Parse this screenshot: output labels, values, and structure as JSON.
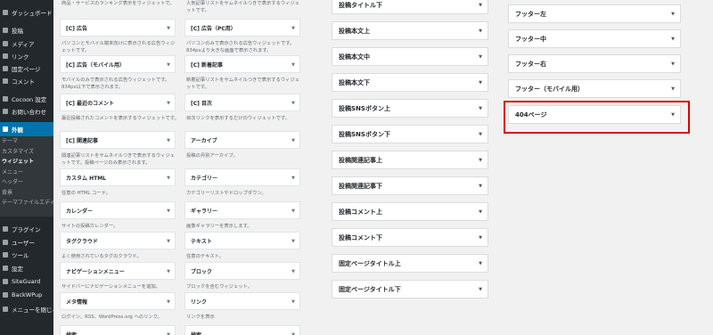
{
  "sidebar": {
    "items": [
      {
        "label": "ダッシュボード",
        "icon": "dashboard-icon"
      },
      {
        "label": "投稿",
        "icon": "pin-icon"
      },
      {
        "label": "メディア",
        "icon": "media-icon"
      },
      {
        "label": "リンク",
        "icon": "link-icon"
      },
      {
        "label": "固定ページ",
        "icon": "page-icon"
      },
      {
        "label": "コメント",
        "icon": "comment-icon"
      },
      {
        "label": "Cocoon 設定",
        "icon": "cocoon-icon"
      },
      {
        "label": "お問い合わせ",
        "icon": "mail-icon"
      },
      {
        "label": "外観",
        "icon": "appearance-icon"
      },
      {
        "label": "プラグイン",
        "icon": "plugin-icon"
      },
      {
        "label": "ユーザー",
        "icon": "user-icon"
      },
      {
        "label": "ツール",
        "icon": "wrench-icon"
      },
      {
        "label": "設定",
        "icon": "settings-icon"
      },
      {
        "label": "SiteGuard",
        "icon": "shield-icon"
      },
      {
        "label": "BackWPup",
        "icon": "backup-icon"
      },
      {
        "label": "メニューを閉じる",
        "icon": "collapse-icon"
      }
    ],
    "submenu": [
      "テーマ",
      "カスタマイズ",
      "ウィジェット",
      "メニュー",
      "ヘッダー",
      "背景",
      "テーマファイルエディター"
    ],
    "active_color": "#0073aa"
  },
  "available_widgets": {
    "col1": [
      {
        "name": "",
        "desc": "商品・サービスのランキング表示をウィジェットで。"
      },
      {
        "name": "[C] 広告",
        "desc": "パソコンとモバイル端末向けに表示される広告ウィジェットです。"
      },
      {
        "name": "[C] 広告（モバイル用）",
        "desc": "モバイルのみで表示される広告ウィジェットです。834px以下で表示されます。"
      },
      {
        "name": "[C] 最近のコメント",
        "desc": "最近投稿されたコメントを表示するウィジェットです。"
      },
      {
        "name": "[C] 関連記事",
        "desc": "関連記事リストをサムネイルつきで表示するウィジェットです。投稿ページのみ表示されます。"
      },
      {
        "name": "カスタム HTML",
        "desc": "任意の HTML コード。"
      },
      {
        "name": "カレンダー",
        "desc": "サイトの投稿カレンダー。"
      },
      {
        "name": "タグクラウド",
        "desc": "よく使用されているタグのクラウド。"
      },
      {
        "name": "ナビゲーションメニュー",
        "desc": "サイドバーにナビゲーションメニューを追加。"
      },
      {
        "name": "メタ情報",
        "desc": "ログイン、RSS、WordPress.org へのリンク。"
      },
      {
        "name": "検索",
        "desc": ""
      }
    ],
    "col2": [
      {
        "name": "",
        "desc": "人気記事リストをサムネイルつきで表示するウィジェットです。"
      },
      {
        "name": "[C] 広告（PC用）",
        "desc": "パソコンのみで表示される広告ウィジェットです。834pxより大きな画面で表示されます。"
      },
      {
        "name": "[C] 新着記事",
        "desc": "新着記事リストをサムネイルつきで表示するウィジェットです。"
      },
      {
        "name": "[C] 目次",
        "desc": "目次リンクを表示するだけのウィジェットです。"
      },
      {
        "name": "アーカイブ",
        "desc": "投稿の月別アーカイブ。"
      },
      {
        "name": "カテゴリー",
        "desc": "カテゴリーリストやドロップダウン。"
      },
      {
        "name": "ギャラリー",
        "desc": "画像ギャラリーを表示します。"
      },
      {
        "name": "テキスト",
        "desc": "任意のテキスト。"
      },
      {
        "name": "ブロック",
        "desc": "ブロックを含むウィジェット。"
      },
      {
        "name": "リンク",
        "desc": "リンクを表示"
      },
      {
        "name": "検索",
        "desc": ""
      }
    ]
  },
  "widget_areas_col3": [
    "投稿タイトル下",
    "投稿本文上",
    "投稿本文中",
    "投稿本文下",
    "投稿SNSボタン上",
    "投稿SNSボタン下",
    "投稿関連記事上",
    "投稿関連記事下",
    "投稿コメント上",
    "投稿コメント下",
    "固定ページタイトル上",
    "固定ページタイトル下"
  ],
  "widget_areas_col4": [
    "フッター左",
    "フッター中",
    "フッター右",
    "フッター（モバイル用）",
    "404ページ"
  ],
  "highlighted_area": "404ページ",
  "highlight_color": "#dc0000",
  "caret": "▼"
}
